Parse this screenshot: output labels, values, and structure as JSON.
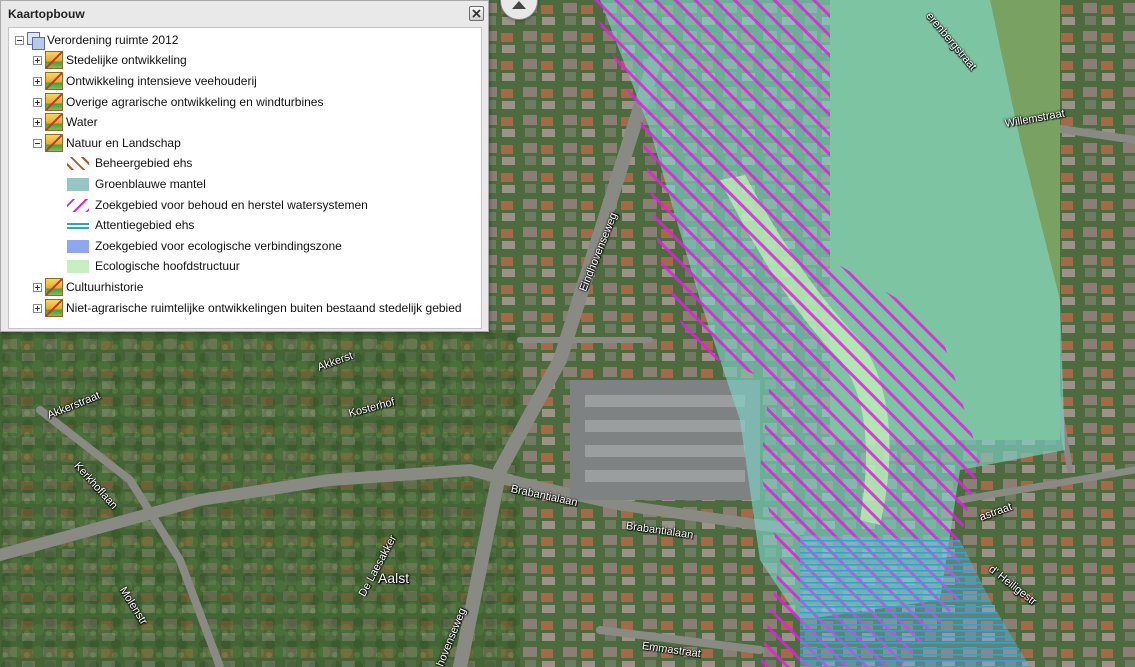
{
  "legend": {
    "title": "Kaartopbouw",
    "root_label": "Verordening ruimte 2012",
    "items": [
      {
        "label": "Stedelijke ontwikkeling",
        "expanded": false
      },
      {
        "label": "Ontwikkeling intensieve veehouderij",
        "expanded": false
      },
      {
        "label": "Overige agrarische ontwikkeling en windturbines",
        "expanded": false
      },
      {
        "label": "Water",
        "expanded": false
      },
      {
        "label": "Natuur en Landschap",
        "expanded": true,
        "children": [
          {
            "label": "Beheergebied ehs",
            "swatch": "hatch-brown"
          },
          {
            "label": "Groenblauwe mantel",
            "swatch": "teal-fill"
          },
          {
            "label": "Zoekgebied voor behoud en herstel watersystemen",
            "swatch": "hatch-magenta"
          },
          {
            "label": "Attentiegebied ehs",
            "swatch": "lines-cyan"
          },
          {
            "label": "Zoekgebied voor ecologische verbindingszone",
            "swatch": "blue-fill"
          },
          {
            "label": "Ecologische hoofdstructuur",
            "swatch": "lightgreen-fill"
          }
        ]
      },
      {
        "label": "Cultuurhistorie",
        "expanded": false
      },
      {
        "label": "Niet-agrarische ruimtelijke ontwikkelingen buiten bestaand stedelijk gebied",
        "expanded": false
      }
    ]
  },
  "map": {
    "streets": {
      "eindhovenseweg": "Eindhovenseweg",
      "akkerstraat": "Akkerstraat",
      "akkerstr_short": "Akkerst",
      "kosterhof": "Kosterhof",
      "kerkhoflaan": "Kerkhoflaan",
      "brabantialaan_1": "Brabantialaan",
      "brabantialaan_2": "Brabantialaan",
      "willemstraat": "Willemstraat",
      "heerenbergstraat": "erenbergstraat",
      "molenstraat": "Molenstr",
      "delaesakker": "De Laesakker",
      "eindhovenseweg_2": "hovenseweg",
      "emmastraat": "Emmastraat",
      "heuvelstraat_right": "astraat",
      "heiligestraat": "d' Heiligestr"
    },
    "place_name": "Aalst",
    "colors": {
      "mantel": "#7fd8cc",
      "zoekgebied_hatch": "#e020e0",
      "attentie_lines": "#2aa8c8",
      "ehs": "#c8f4b8"
    }
  }
}
